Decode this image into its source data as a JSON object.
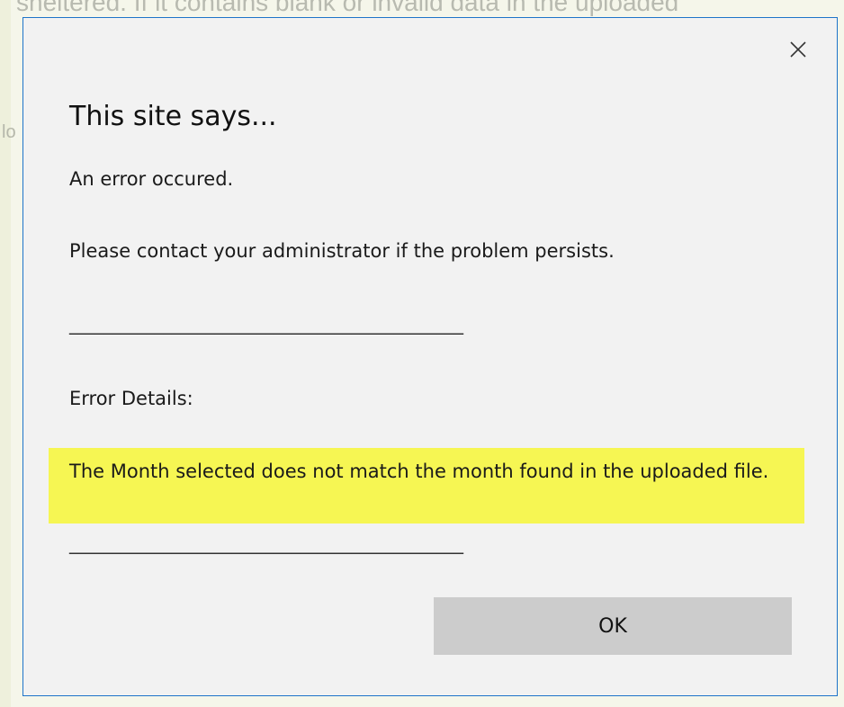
{
  "background": {
    "top_text": "sheltered. If it contains blank or invalid data in the uploaded",
    "left_fragment": "lo"
  },
  "dialog": {
    "close_icon": "close-icon",
    "title": "This site says...",
    "message_line1": "An error occured.",
    "message_line2": "Please contact your administrator if the problem persists.",
    "separator": "______________________________________________",
    "details_label": "Error Details:",
    "details_text": "The Month selected does not match the month found in the uploaded file.",
    "separator_bottom": "______________________________________________",
    "ok_label": "OK"
  },
  "colors": {
    "dialog_border": "#1e74c9",
    "dialog_bg": "#f2f2f2",
    "highlight": "#f6f653",
    "ok_button": "#cccccc"
  }
}
